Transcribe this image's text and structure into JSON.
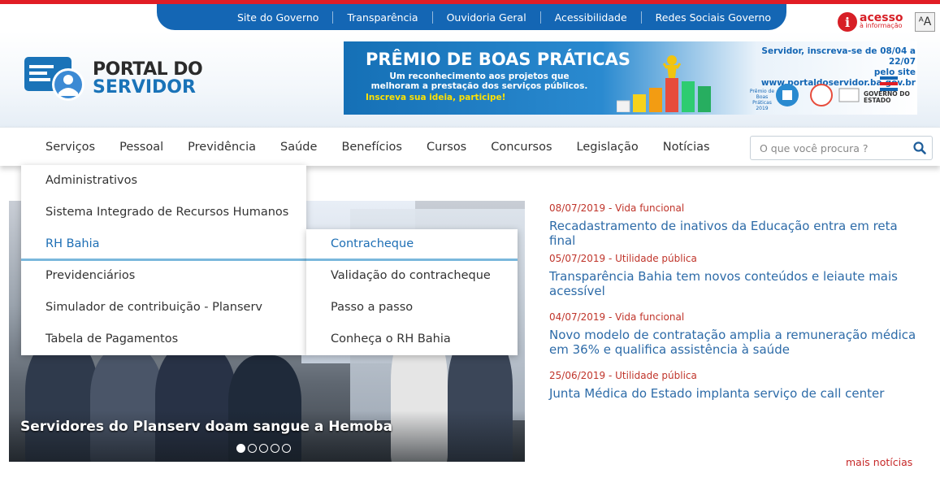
{
  "top_bar": {
    "links": [
      "Site do Governo",
      "Transparência",
      "Ouvidoria Geral",
      "Acessibilidade",
      "Redes Sociais Governo"
    ]
  },
  "accessibility": {
    "icon_letter": "i",
    "title": "acesso",
    "subtitle": "à informação",
    "font_button": "ᴬA"
  },
  "logo": {
    "line1": "PORTAL DO",
    "line2": "SERVIDOR"
  },
  "banner": {
    "title": "PRÊMIO DE BOAS PRÁTICAS",
    "subtitle": "Um reconhecimento aos projetos que melhoram a prestação dos serviços públicos.",
    "cta": "Inscreva sua ideia, participe!",
    "right_text_1": "Servidor, inscreva-se de 08/04 a 22/07",
    "right_text_2": "pelo site www.portaldoservidor.ba.gov.br",
    "small_label": "Prêmio de Boas Práticas 2019",
    "gov_logo": "GOVERNO DO ESTADO"
  },
  "nav": {
    "items": [
      "Serviços",
      "Pessoal",
      "Previdência",
      "Saúde",
      "Benefícios",
      "Cursos",
      "Concursos",
      "Legislação",
      "Notícias"
    ],
    "search_placeholder": "O que você procura ?"
  },
  "dropdown": {
    "items": [
      "Administrativos",
      "Sistema Integrado de Recursos Humanos",
      "RH Bahia",
      "Previdenciários",
      "Simulador de contribuição - Planserv",
      "Tabela de Pagamentos"
    ],
    "active_index": 2
  },
  "submenu": {
    "items": [
      "Contracheque",
      "Validação do contracheque",
      "Passo a passo",
      "Conheça o RH Bahia"
    ],
    "active_index": 0
  },
  "hero": {
    "caption": "Servidores do Planserv doam sangue a Hemoba",
    "slide_count": 5,
    "active_slide": 1
  },
  "news": [
    {
      "meta": "08/07/2019 - Vida funcional",
      "title": "Recadastramento de inativos da Educação entra em reta final"
    },
    {
      "meta": "05/07/2019 - Utilidade pública",
      "title": "Transparência Bahia tem novos conteúdos e leiaute mais acessível"
    },
    {
      "meta": "04/07/2019 - Vida funcional",
      "title": "Novo modelo de contratação amplia a remuneração médica em 36% e qualifica assistência à saúde"
    },
    {
      "meta": "25/06/2019 - Utilidade pública",
      "title": "Junta Médica do Estado implanta serviço de call center"
    }
  ],
  "more_news": "mais notícias",
  "colors": {
    "brand_blue": "#1466b4",
    "accent_red": "#e11d25",
    "link_blue": "#2d6ba8",
    "meta_red": "#c0352b"
  }
}
